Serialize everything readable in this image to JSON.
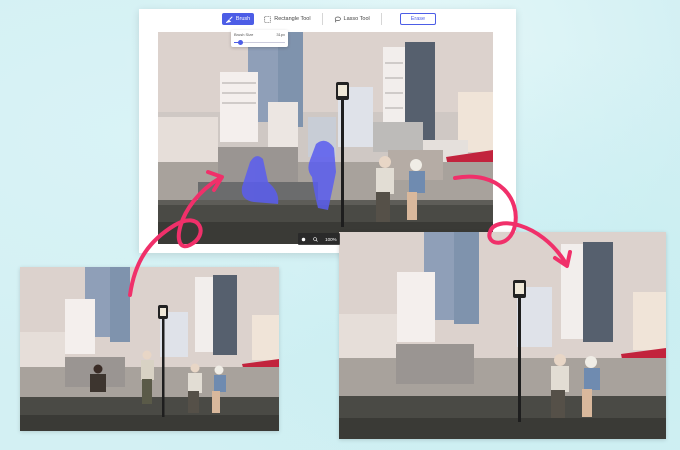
{
  "toolbar": {
    "brush_label": "Brush",
    "rectangle_label": "Rectangle Tool",
    "lasso_label": "Lasso Tool",
    "erase_label": "Erase"
  },
  "brush_popover": {
    "size_label": "Brush Size",
    "size_value": "31px",
    "size_fraction": 0.12
  },
  "zoom": {
    "value": "100%"
  },
  "icons": {
    "brush": "brush-icon",
    "rectangle": "rectangle-select-icon",
    "lasso": "lasso-icon",
    "hand": "hand-icon",
    "zoom": "zoom-icon"
  },
  "colors": {
    "accent": "#4c5de6",
    "mask": "#5a5df0",
    "arrow": "#f0306a"
  }
}
